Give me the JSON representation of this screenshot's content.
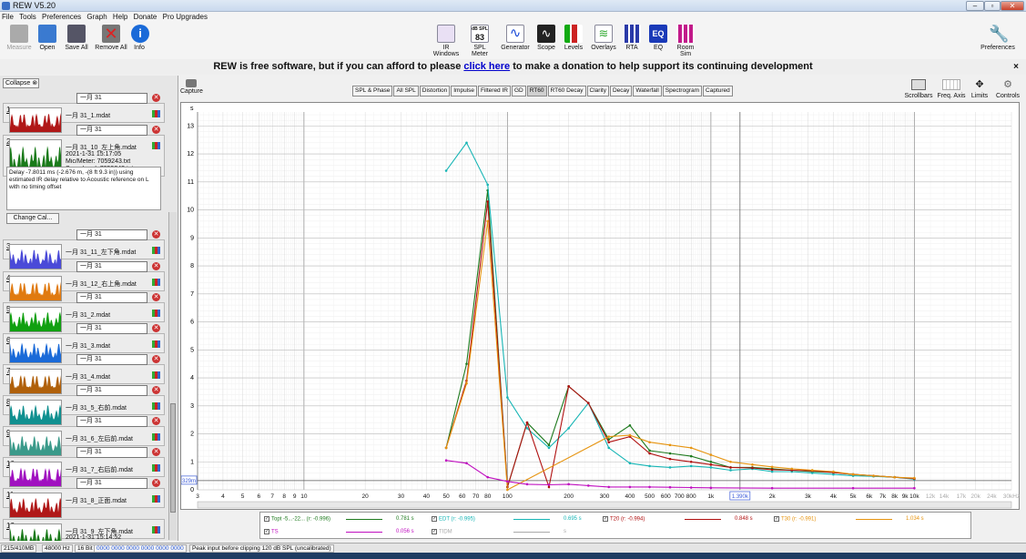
{
  "window": {
    "title": "REW V5.20"
  },
  "menu": [
    "File",
    "Tools",
    "Preferences",
    "Graph",
    "Help",
    "Donate",
    "Pro Upgrades"
  ],
  "toolbar": {
    "left": [
      "Measure",
      "Open",
      "Save All",
      "Remove All",
      "Info"
    ],
    "center": [
      "IR Windows",
      "SPL Meter",
      "Generator",
      "Scope",
      "Levels",
      "Overlays",
      "RTA",
      "EQ",
      "Room Sim"
    ],
    "spl_badge": "83",
    "spl_top": "dB SPL",
    "right": "Preferences"
  },
  "banner": {
    "before": "REW is free software, but if you can afford to please ",
    "link": "click here",
    "after": " to make a donation to help support its continuing development",
    "close": "×"
  },
  "left_panel": {
    "collapse": "Collapse",
    "change_cal": "Change Cal...",
    "delay_text": "Delay -7.8011 ms (-2.676 m, -(8 ft 9.3 in)) using estimated IR delay relative to Acoustic reference on L with no timing offset",
    "selected": {
      "name": "一月 31_10_左上角.mdat",
      "date": "2021-1-31 15:17:05",
      "mic": "Mic/Meter: 7059243.txt",
      "sound": "Soundcard: 7059243.txt"
    },
    "bottom": {
      "name": "一月 31_9_左下角.mdat",
      "date": "2021-1-31 15:14:52",
      "mic": "Mic/Meter: 7059243.txt"
    },
    "measurements": [
      {
        "num": "1",
        "name": "一月 31_1.mdat",
        "edit": "一月 31",
        "color": "#b01818"
      },
      {
        "num": "2",
        "name": "一月 31_10_左上角.mdat",
        "edit": "一月 31",
        "color": "#1a7a1a"
      },
      {
        "num": "3",
        "name": "一月 31_11_左下角.mdat",
        "edit": "一月 31",
        "color": "#4a4ad8"
      },
      {
        "num": "4",
        "name": "一月 31_12_右上角.mdat",
        "edit": "一月 31",
        "color": "#e07a10"
      },
      {
        "num": "5",
        "name": "一月 31_2.mdat",
        "edit": "一月 31",
        "color": "#10a010"
      },
      {
        "num": "6",
        "name": "一月 31_3.mdat",
        "edit": "一月 31",
        "color": "#1a6ad8"
      },
      {
        "num": "7",
        "name": "一月 31_4.mdat",
        "edit": "一月 31",
        "color": "#b0600a"
      },
      {
        "num": "8",
        "name": "一月 31_5_右前.mdat",
        "edit": "一月 31",
        "color": "#109090"
      },
      {
        "num": "9",
        "name": "一月 31_6_左后前.mdat",
        "edit": "一月 31",
        "color": "#3a9a8a"
      },
      {
        "num": "10",
        "name": "一月 31_7_右后前.mdat",
        "edit": "一月 31",
        "color": "#a010c0"
      },
      {
        "num": "11",
        "name": "一月 31_8_正面.mdat",
        "edit": "一月 31",
        "color": "#b01818"
      },
      {
        "num": "12",
        "name": "一月 31_9_左下角.mdat",
        "edit": "",
        "color": "#1a7a1a"
      }
    ]
  },
  "capture": "Capture",
  "tabs": [
    "SPL & Phase",
    "All SPL",
    "Distortion",
    "Impulse",
    "Filtered IR",
    "GD",
    "RT60",
    "RT60 Decay",
    "Clarity",
    "Decay",
    "Waterfall",
    "Spectrogram",
    "Captured"
  ],
  "selected_tab": "RT60",
  "right_buttons": [
    "Scrollbars",
    "Freq. Axis",
    "Limits",
    "Controls"
  ],
  "axis": {
    "y_unit": "s",
    "cursor_y": "329m",
    "cursor_x": "1.390k",
    "yticks": [
      "0",
      "1",
      "2",
      "3",
      "4",
      "5",
      "6",
      "7",
      "8",
      "9",
      "10",
      "11",
      "12",
      "13"
    ],
    "xticks": [
      [
        3,
        "3"
      ],
      [
        4,
        "4"
      ],
      [
        5,
        "5"
      ],
      [
        6,
        "6"
      ],
      [
        7,
        "7"
      ],
      [
        8,
        "8"
      ],
      [
        9,
        "9"
      ],
      [
        10,
        "10"
      ],
      [
        20,
        "20"
      ],
      [
        30,
        "30"
      ],
      [
        40,
        "40"
      ],
      [
        50,
        "50"
      ],
      [
        60,
        "60"
      ],
      [
        70,
        "70"
      ],
      [
        80,
        "80"
      ],
      [
        100,
        "100"
      ],
      [
        200,
        "200"
      ],
      [
        300,
        "300"
      ],
      [
        400,
        "400"
      ],
      [
        500,
        "500"
      ],
      [
        600,
        "600"
      ],
      [
        700,
        "700"
      ],
      [
        800,
        "800"
      ],
      [
        1000,
        "1k"
      ],
      [
        2000,
        "2k"
      ],
      [
        3000,
        "3k"
      ],
      [
        4000,
        "4k"
      ],
      [
        5000,
        "5k"
      ],
      [
        6000,
        "6k"
      ],
      [
        7000,
        "7k"
      ],
      [
        8000,
        "8k"
      ],
      [
        9000,
        "9k"
      ],
      [
        10000,
        "10k"
      ],
      [
        12000,
        "12k"
      ],
      [
        14000,
        "14k"
      ],
      [
        17000,
        "17k"
      ],
      [
        20000,
        "20k"
      ],
      [
        24000,
        "24k"
      ],
      [
        30000,
        "30kHz"
      ]
    ]
  },
  "chart_data": {
    "type": "line",
    "xscale": "log",
    "xlim": [
      3,
      30000
    ],
    "ylim": [
      0,
      13.5
    ],
    "ylabel": "s",
    "grid": true,
    "series": [
      {
        "name": "Topt -5...-22... (r: -0.996)",
        "color": "#1e7a1e",
        "x": [
          50,
          63,
          80,
          100,
          125,
          160,
          200,
          250,
          315,
          400,
          500,
          630,
          800,
          1000,
          1250,
          1600,
          2000,
          2500,
          3150,
          4000,
          5000,
          6300,
          8000,
          10000
        ],
        "y": [
          1.5,
          4.5,
          10.7,
          0.1,
          2.4,
          1.6,
          3.7,
          3.1,
          1.8,
          2.3,
          1.4,
          1.3,
          1.2,
          1.0,
          0.8,
          0.8,
          0.75,
          0.7,
          0.65,
          0.62,
          0.55,
          0.5,
          0.45,
          0.4
        ]
      },
      {
        "name": "EDT (r: -0.995)",
        "color": "#17b5b5",
        "x": [
          50,
          63,
          80,
          100,
          125,
          160,
          200,
          250,
          315,
          400,
          500,
          630,
          800,
          1000,
          1250,
          1600,
          2000,
          2500,
          3150,
          4000,
          5000,
          6300,
          8000,
          10000
        ],
        "y": [
          11.4,
          12.4,
          10.9,
          3.3,
          2.2,
          1.5,
          2.2,
          3.1,
          1.5,
          0.95,
          0.85,
          0.8,
          0.85,
          0.8,
          0.7,
          0.75,
          0.65,
          0.65,
          0.6,
          0.55,
          0.5,
          0.48,
          0.45,
          0.38
        ]
      },
      {
        "name": "T20 (r: -0.994)",
        "color": "#b01010",
        "x": [
          50,
          63,
          80,
          100,
          125,
          160,
          200,
          250,
          315,
          400,
          500,
          630,
          800,
          1000,
          1250,
          1600,
          2000,
          2500,
          3150,
          4000,
          5000,
          6300,
          8000,
          10000
        ],
        "y": [
          1.5,
          3.9,
          10.3,
          0.1,
          2.4,
          0.1,
          3.7,
          3.1,
          1.7,
          1.9,
          1.3,
          1.1,
          1.0,
          0.9,
          0.8,
          0.78,
          0.72,
          0.7,
          0.68,
          0.62,
          0.55,
          0.5,
          0.45,
          0.4
        ]
      },
      {
        "name": "T30 (r: -0.991)",
        "color": "#e69410",
        "x": [
          50,
          63,
          80,
          100,
          315,
          400,
          500,
          630,
          800,
          1000,
          1250,
          1600,
          2000,
          2500,
          3150,
          4000,
          5000,
          6300,
          8000,
          10000
        ],
        "y": [
          1.5,
          3.8,
          9.6,
          0.0,
          1.9,
          1.95,
          1.7,
          1.6,
          1.5,
          1.25,
          1.0,
          0.9,
          0.82,
          0.75,
          0.7,
          0.65,
          0.55,
          0.5,
          0.45,
          0.42
        ]
      },
      {
        "name": "TS",
        "color": "#c010c0",
        "x": [
          50,
          63,
          80,
          100,
          125,
          160,
          200,
          250,
          315,
          400,
          500,
          630,
          800,
          1000,
          2000,
          5000,
          10000
        ],
        "y": [
          1.05,
          0.95,
          0.45,
          0.3,
          0.2,
          0.18,
          0.2,
          0.15,
          0.1,
          0.1,
          0.1,
          0.09,
          0.08,
          0.07,
          0.06,
          0.06,
          0.06
        ]
      }
    ]
  },
  "legend": [
    {
      "label": "Topt -5...-22... (r: -0.996)",
      "value": "0.781 s",
      "color": "#1e7a1e",
      "checked": "✓"
    },
    {
      "label": "EDT (r: -0.995)",
      "value": "0.695 s",
      "color": "#17b5b5",
      "checked": "✓"
    },
    {
      "label": "T20 (r: -0.994)",
      "value": "0.848 s",
      "color": "#b01010",
      "checked": "✓"
    },
    {
      "label": "T30 (r: -0.991)",
      "value": "1.034 s",
      "color": "#e69410",
      "checked": "✓"
    },
    {
      "label": "TS",
      "value": "0.056 s",
      "color": "#c010c0",
      "checked": "✓"
    },
    {
      "label": "TIDM",
      "value": "s",
      "color": "#aaaaaa",
      "checked": "✓"
    }
  ],
  "status": {
    "mem": "215/410MB",
    "rate": "48000 Hz",
    "bits": "16 Bit",
    "hex": "0000 0000  0000 0000  0000 0000",
    "msg": "Peak input before clipping 120 dB SPL (uncalibrated)"
  }
}
